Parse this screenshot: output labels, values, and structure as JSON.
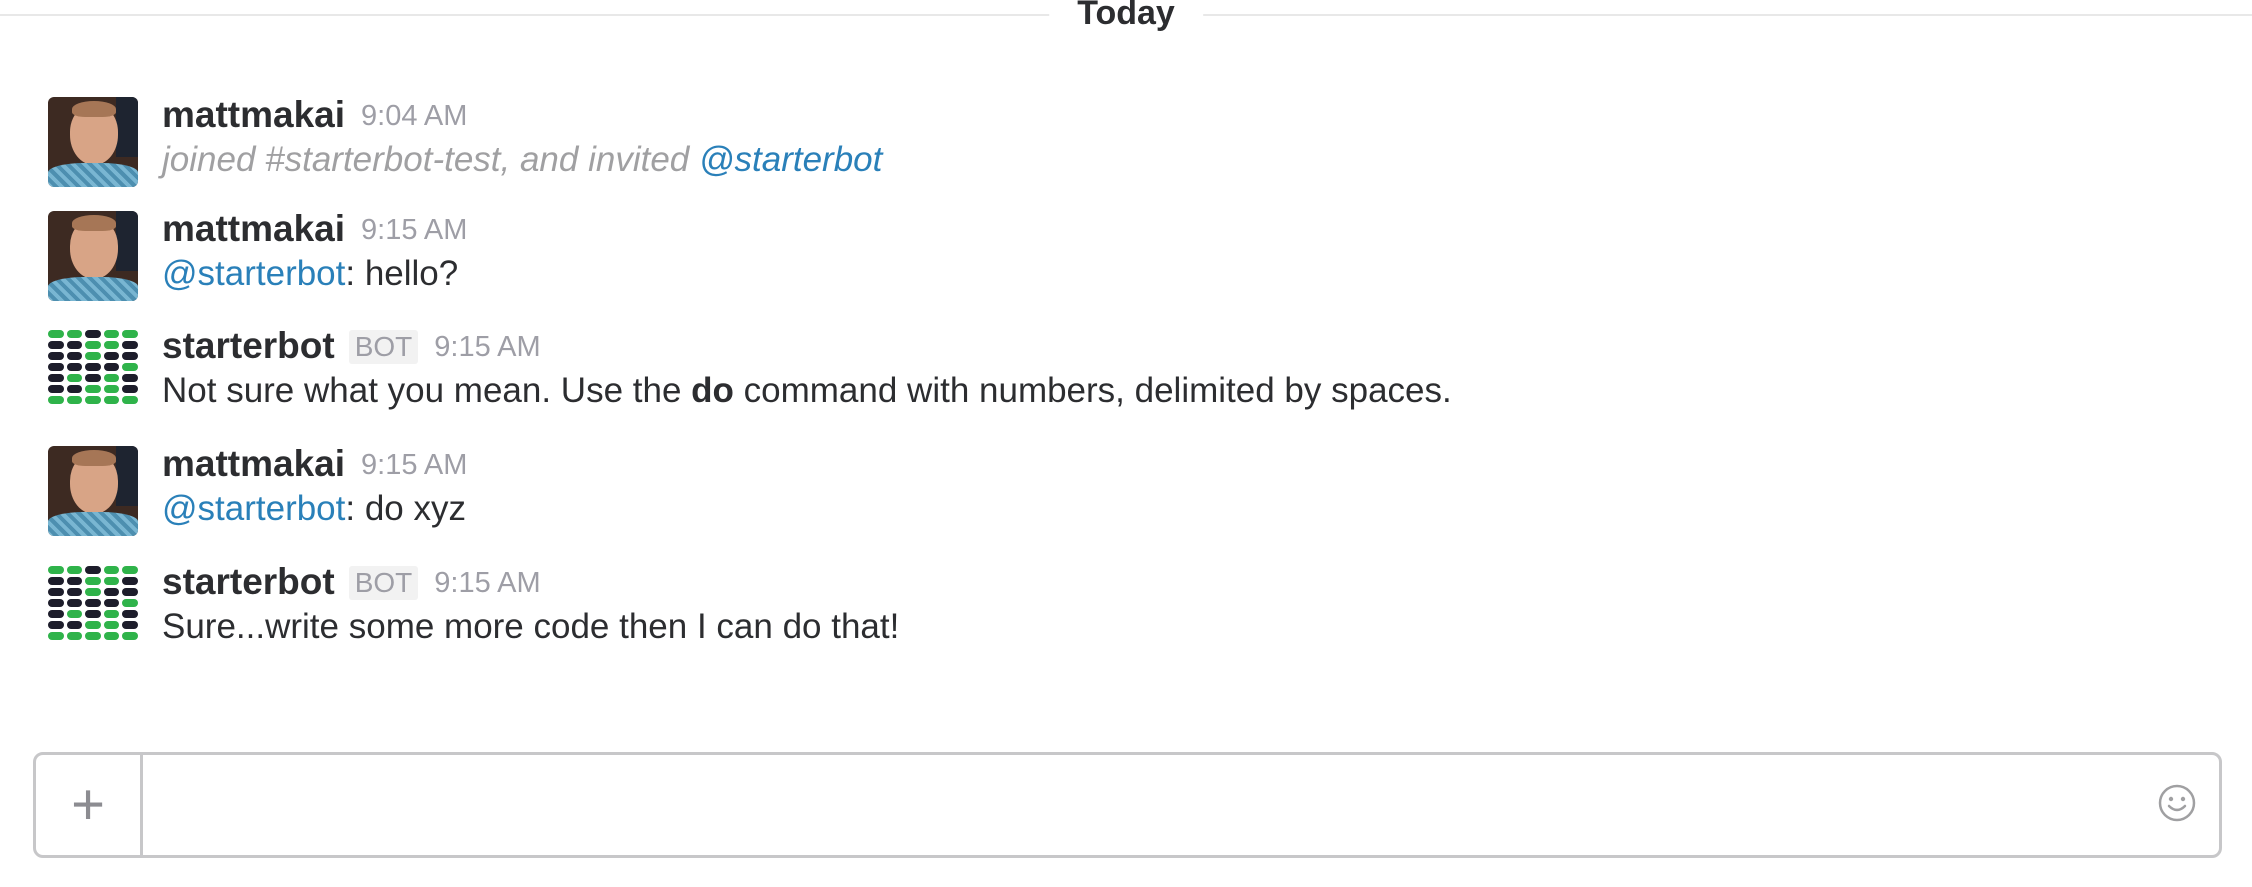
{
  "divider": {
    "label": "Today"
  },
  "messages": [
    {
      "author": "mattmakai",
      "time": "9:04 AM",
      "avatar": "person-avatar",
      "text_prefix": "joined #starterbot-test, and invited ",
      "mention": "@starterbot"
    },
    {
      "author": "mattmakai",
      "time": "9:15 AM",
      "avatar": "person-avatar",
      "mention": "@starterbot",
      "text_suffix": ": hello?"
    },
    {
      "author": "starterbot",
      "badge": "BOT",
      "time": "9:15 AM",
      "avatar": "bot-avatar",
      "text_prefix": "Not sure what you mean. Use the ",
      "text_bold": "do",
      "text_suffix": " command with numbers, delimited by spaces."
    },
    {
      "author": "mattmakai",
      "time": "9:15 AM",
      "avatar": "person-avatar",
      "mention": "@starterbot",
      "text_suffix": ": do xyz"
    },
    {
      "author": "starterbot",
      "badge": "BOT",
      "time": "9:15 AM",
      "avatar": "bot-avatar",
      "text": "Sure...write some more code then I can do that!"
    }
  ],
  "composer": {
    "plus_icon": "plus-icon",
    "placeholder": "",
    "emoji_icon": "emoji-icon"
  },
  "colors": {
    "mention": "#2a80b9",
    "bot_green": "#2fb34a",
    "bot_dark": "#1d1d2b"
  }
}
